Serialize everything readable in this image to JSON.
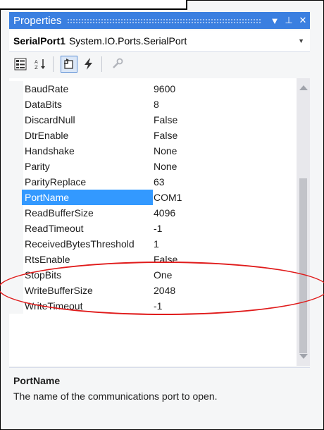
{
  "panel": {
    "title": "Properties",
    "buttons": {
      "dropdown": "▼",
      "pin": "⊥",
      "close": "✕"
    }
  },
  "object_selector": {
    "name": "SerialPort1",
    "type": "System.IO.Ports.SerialPort"
  },
  "toolbar": {
    "icons": [
      "categorized-icon",
      "alphabetical-icon",
      "properties-icon",
      "events-icon",
      "property-pages-icon"
    ],
    "active": "properties-icon"
  },
  "properties": [
    {
      "name": "BaudRate",
      "value": "9600"
    },
    {
      "name": "DataBits",
      "value": "8"
    },
    {
      "name": "DiscardNull",
      "value": "False"
    },
    {
      "name": "DtrEnable",
      "value": "False"
    },
    {
      "name": "Handshake",
      "value": "None"
    },
    {
      "name": "Parity",
      "value": "None"
    },
    {
      "name": "ParityReplace",
      "value": "63"
    },
    {
      "name": "PortName",
      "value": "COM1"
    },
    {
      "name": "ReadBufferSize",
      "value": "4096"
    },
    {
      "name": "ReadTimeout",
      "value": "-1"
    },
    {
      "name": "ReceivedBytesThreshold",
      "value": "1"
    },
    {
      "name": "RtsEnable",
      "value": "False"
    },
    {
      "name": "StopBits",
      "value": "One"
    },
    {
      "name": "WriteBufferSize",
      "value": "2048"
    },
    {
      "name": "WriteTimeout",
      "value": "-1"
    }
  ],
  "selected_property": "PortName",
  "description": {
    "title": "PortName",
    "text": "The name of the communications port to open."
  },
  "colors": {
    "titlebar": "#3a7fe0",
    "selection": "#3399ff",
    "annotation": "#e01b1b"
  }
}
